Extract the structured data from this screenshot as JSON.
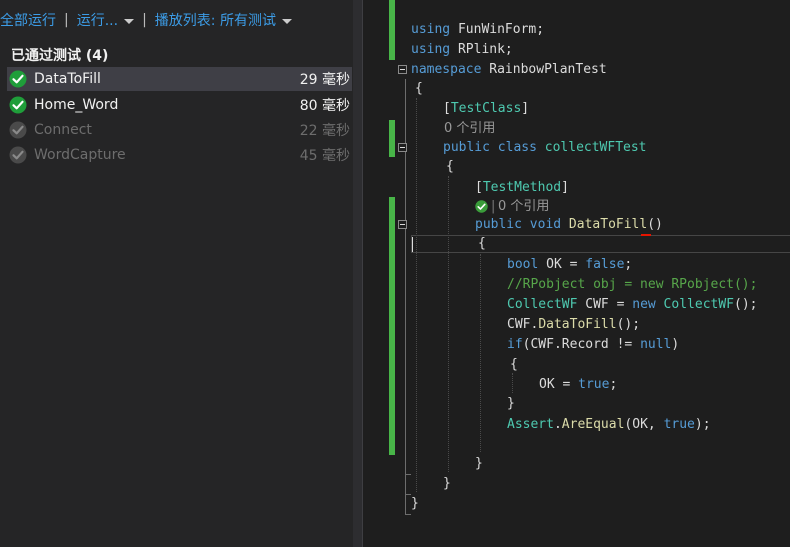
{
  "test_explorer": {
    "toolbar": {
      "run_all": "全部运行",
      "run": "运行...",
      "playlist": "播放列表: 所有测试"
    },
    "group_header": "已通过测试 (4)",
    "tests": [
      {
        "name": "DataToFill",
        "duration": "29 毫秒"
      },
      {
        "name": "Home_Word",
        "duration": "80 毫秒"
      },
      {
        "name": "Connect",
        "duration": "22 毫秒"
      },
      {
        "name": "WordCapture",
        "duration": "45 毫秒"
      }
    ]
  },
  "editor": {
    "lines": {
      "using1_kw": "using",
      "using1_ns": " FunWinForm;",
      "using2_kw": "using",
      "using2_ns": " RPlink;",
      "ns_kw": "namespace",
      "ns_name": " RainbowPlanTest",
      "ob1": "{",
      "attr1_open": "[",
      "attr1_name": "TestClass",
      "attr1_close": "]",
      "refs1": "0 个引用",
      "cls_mod": "public",
      "cls_kw": " class",
      "cls_name": " collectWFTest",
      "ob2": "{",
      "attr2_open": "[",
      "attr2_name": "TestMethod",
      "attr2_close": "]",
      "refs2": "0 个引用",
      "m_mod": "public",
      "m_void": " void",
      "m_name": " DataToFill",
      "m_parens": "()",
      "ob3": "{",
      "l1_kw": "bool",
      "l1_a": " OK = ",
      "l1_val": "false",
      "l1_b": ";",
      "l2_comment": "//RPobject obj = new RPobject();",
      "l3_t": "CollectWF",
      "l3_a": " CWF = ",
      "l3_new": "new",
      "l3_t2": " CollectWF",
      "l3_b": "();",
      "l4_a": "CWF.",
      "l4_m": "DataToFill",
      "l4_b": "();",
      "l5_kw": "if",
      "l5_a": "(CWF.Record != ",
      "l5_null": "null",
      "l5_b": ")",
      "ob4": "{",
      "l6_a": "OK = ",
      "l6_val": "true",
      "l6_b": ";",
      "cb4": "}",
      "l7_t": "Assert",
      "l7_a": ".",
      "l7_m": "AreEqual",
      "l7_b": "(OK, ",
      "l7_val": "true",
      "l7_c": ");",
      "cb3": "}",
      "cb2": "}",
      "cb1": "}"
    }
  },
  "colors": {
    "keyword": "#569cd6",
    "type": "#4ec9b0",
    "comment": "#57a64a",
    "method": "#dcdcaa",
    "pass_green": "#1f9e3a",
    "change_margin": "#48b548",
    "toolbar_link": "#3c9ce6"
  }
}
